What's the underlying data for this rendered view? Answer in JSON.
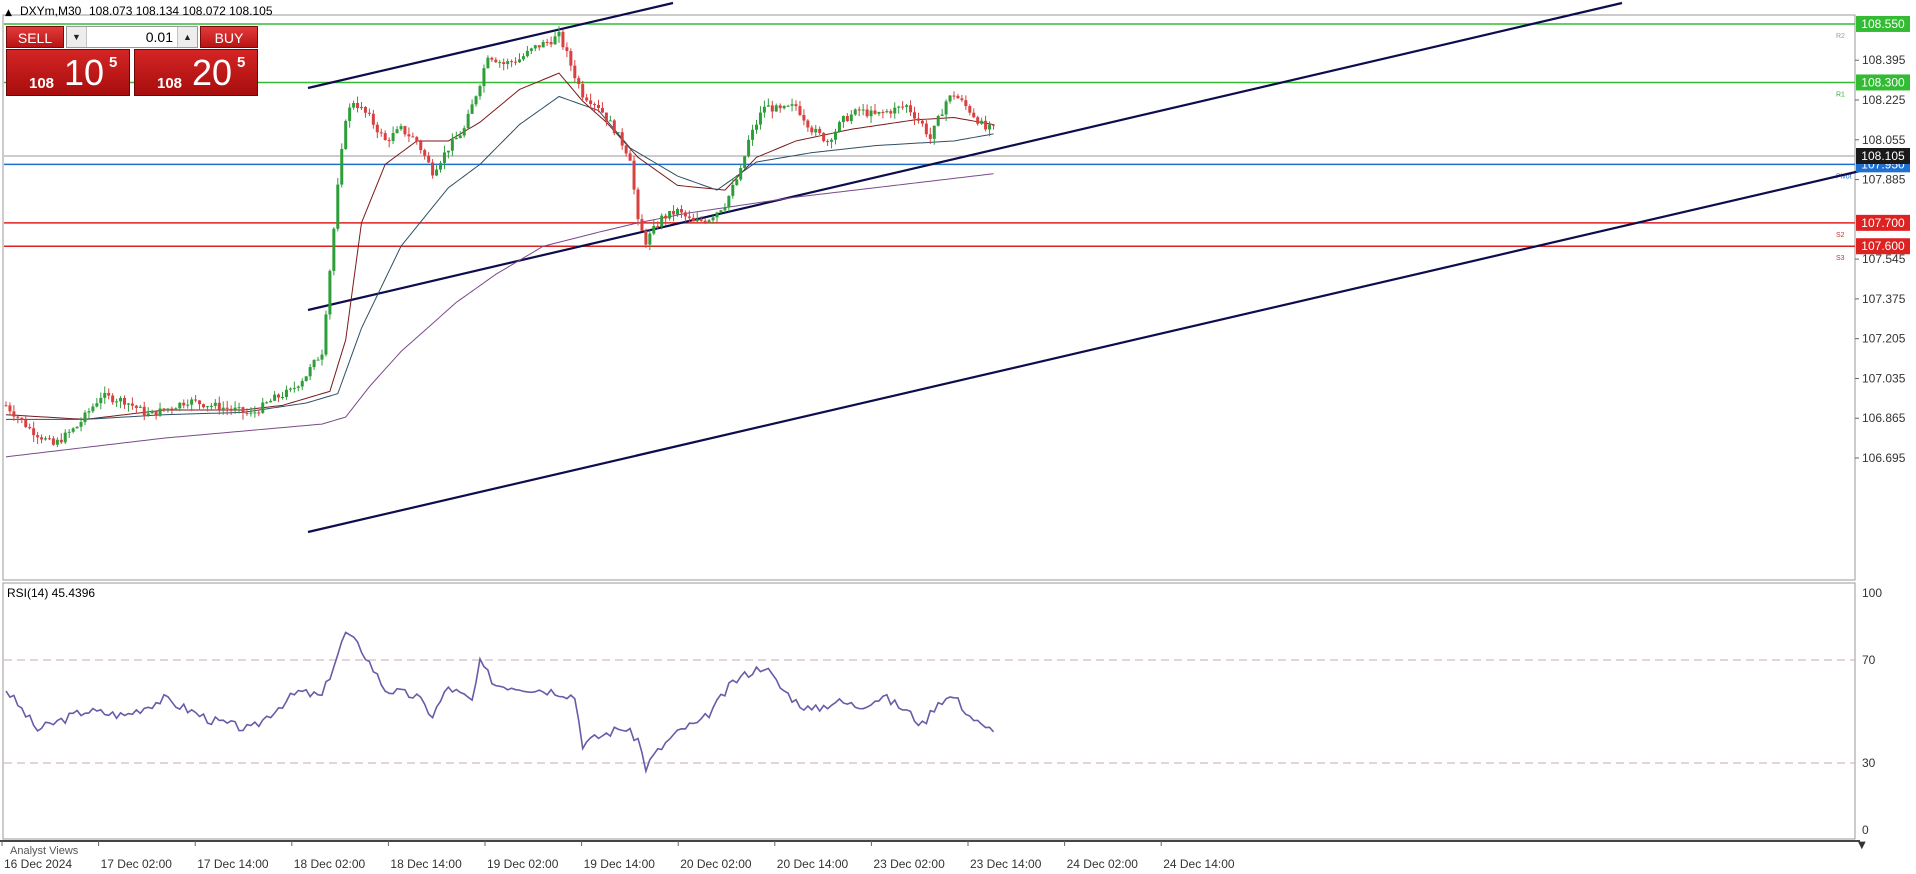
{
  "header": {
    "symbol": "DXYm,M30",
    "ohlc": "108.073 108.134 108.072 108.105"
  },
  "trade_panel": {
    "sell_label": "SELL",
    "buy_label": "BUY",
    "lot": "0.01",
    "bid_small": "108",
    "bid_big": "10",
    "bid_sup": "5",
    "ask_small": "108",
    "ask_big": "20",
    "ask_sup": "5"
  },
  "price_axis": {
    "ticks": [
      "108.395",
      "108.225",
      "108.055",
      "107.885",
      "107.545",
      "107.375",
      "107.205",
      "107.035",
      "106.865",
      "106.695"
    ],
    "current_price": "108.105"
  },
  "levels": [
    {
      "price": 108.55,
      "label": "108.550",
      "tag": "R2",
      "color": "#33bb33",
      "tag_color": "#88aa88"
    },
    {
      "price": 108.3,
      "label": "108.300",
      "tag": "R1",
      "color": "#33bb33",
      "tag_color": "#44aa44"
    },
    {
      "price": 107.95,
      "label": "107.950",
      "tag": "Pivot",
      "color": "#1f6fd1",
      "tag_color": "#1f6fd1"
    },
    {
      "price": 107.7,
      "label": "107.700",
      "tag": "S2",
      "color": "#dd2222",
      "tag_color": "#cc3333"
    },
    {
      "price": 107.6,
      "label": "107.600",
      "tag": "S3",
      "color": "#dd2222",
      "tag_color": "#cc3333"
    }
  ],
  "rsi": {
    "label": "RSI(14) 45.4396",
    "ticks": [
      "100",
      "70",
      "30",
      "0"
    ],
    "color": "#6b5aa8"
  },
  "time_axis": {
    "labels": [
      "16 Dec 2024",
      "17 Dec 02:00",
      "17 Dec 14:00",
      "18 Dec 02:00",
      "18 Dec 14:00",
      "19 Dec 02:00",
      "19 Dec 14:00",
      "20 Dec 02:00",
      "20 Dec 14:00",
      "23 Dec 02:00",
      "23 Dec 14:00",
      "24 Dec 02:00",
      "24 Dec 14:00"
    ]
  },
  "bottom_tab": "Analyst Views",
  "colors": {
    "bull": "#2e9e3a",
    "bear": "#d94040",
    "channel": "#0d0d4d",
    "ma_fast": "#7a1a1a",
    "ma_mid": "#2f4f66",
    "ma_slow": "#7a4a8a"
  },
  "chart_data": {
    "type": "candlestick",
    "series": [
      {
        "name": "",
        "anchors": [
          [
            0,
            106.92
          ],
          [
            6,
            106.82
          ],
          [
            12,
            106.75
          ],
          [
            18,
            106.83
          ],
          [
            24,
            106.96
          ],
          [
            30,
            106.94
          ],
          [
            36,
            106.88
          ],
          [
            40,
            106.9
          ],
          [
            46,
            106.94
          ],
          [
            52,
            106.92
          ],
          [
            58,
            106.9
          ],
          [
            62,
            106.88
          ],
          [
            68,
            106.95
          ],
          [
            72,
            106.98
          ],
          [
            76,
            107.05
          ],
          [
            80,
            107.15
          ],
          [
            84,
            107.85
          ],
          [
            86,
            108.15
          ],
          [
            88,
            108.22
          ],
          [
            92,
            108.15
          ],
          [
            96,
            108.05
          ],
          [
            100,
            108.1
          ],
          [
            104,
            108.05
          ],
          [
            108,
            107.92
          ],
          [
            112,
            108.02
          ],
          [
            116,
            108.1
          ],
          [
            120,
            108.3
          ],
          [
            122,
            108.42
          ],
          [
            126,
            108.38
          ],
          [
            130,
            108.4
          ],
          [
            134,
            108.45
          ],
          [
            138,
            108.48
          ],
          [
            140,
            108.5
          ],
          [
            142,
            108.42
          ],
          [
            144,
            108.33
          ],
          [
            146,
            108.25
          ],
          [
            150,
            108.2
          ],
          [
            154,
            108.1
          ],
          [
            158,
            107.98
          ],
          [
            160,
            107.7
          ],
          [
            162,
            107.62
          ],
          [
            166,
            107.72
          ],
          [
            170,
            107.75
          ],
          [
            174,
            107.7
          ],
          [
            178,
            107.72
          ],
          [
            182,
            107.78
          ],
          [
            186,
            107.92
          ],
          [
            188,
            108.05
          ],
          [
            192,
            108.2
          ],
          [
            196,
            108.18
          ],
          [
            200,
            108.2
          ],
          [
            204,
            108.1
          ],
          [
            208,
            108.05
          ],
          [
            212,
            108.14
          ],
          [
            216,
            108.18
          ],
          [
            220,
            108.16
          ],
          [
            224,
            108.18
          ],
          [
            228,
            108.2
          ],
          [
            232,
            108.12
          ],
          [
            234,
            108.06
          ],
          [
            238,
            108.22
          ],
          [
            240,
            108.25
          ],
          [
            244,
            108.18
          ],
          [
            248,
            108.1
          ],
          [
            250,
            108.105
          ]
        ]
      },
      {
        "name": "",
        "anchors": [
          [
            0,
            106.88
          ],
          [
            20,
            106.86
          ],
          [
            40,
            106.9
          ],
          [
            60,
            106.9
          ],
          [
            70,
            106.92
          ],
          [
            82,
            106.98
          ],
          [
            86,
            107.2
          ],
          [
            90,
            107.7
          ],
          [
            96,
            107.95
          ],
          [
            104,
            108.05
          ],
          [
            112,
            108.05
          ],
          [
            120,
            108.13
          ],
          [
            130,
            108.27
          ],
          [
            140,
            108.34
          ],
          [
            146,
            108.22
          ],
          [
            152,
            108.13
          ],
          [
            160,
            107.98
          ],
          [
            170,
            107.86
          ],
          [
            182,
            107.84
          ],
          [
            190,
            107.98
          ],
          [
            200,
            108.05
          ],
          [
            214,
            108.1
          ],
          [
            230,
            108.14
          ],
          [
            240,
            108.15
          ],
          [
            250,
            108.12
          ]
        ]
      },
      {
        "name": "",
        "anchors": [
          [
            0,
            106.86
          ],
          [
            20,
            106.86
          ],
          [
            40,
            106.88
          ],
          [
            60,
            106.89
          ],
          [
            76,
            106.93
          ],
          [
            84,
            106.97
          ],
          [
            90,
            107.25
          ],
          [
            100,
            107.6
          ],
          [
            112,
            107.85
          ],
          [
            120,
            107.95
          ],
          [
            130,
            108.12
          ],
          [
            140,
            108.24
          ],
          [
            150,
            108.18
          ],
          [
            158,
            108.02
          ],
          [
            170,
            107.9
          ],
          [
            180,
            107.84
          ],
          [
            190,
            107.96
          ],
          [
            204,
            108.0
          ],
          [
            220,
            108.03
          ],
          [
            240,
            108.05
          ],
          [
            250,
            108.08
          ]
        ]
      },
      {
        "name": "",
        "anchors": [
          [
            0,
            106.7
          ],
          [
            20,
            106.74
          ],
          [
            40,
            106.78
          ],
          [
            60,
            106.81
          ],
          [
            80,
            106.84
          ],
          [
            86,
            106.87
          ],
          [
            92,
            107.0
          ],
          [
            100,
            107.15
          ],
          [
            114,
            107.36
          ],
          [
            124,
            107.48
          ],
          [
            136,
            107.6
          ],
          [
            150,
            107.66
          ],
          [
            160,
            107.7
          ],
          [
            172,
            107.74
          ],
          [
            184,
            107.77
          ],
          [
            200,
            107.81
          ],
          [
            220,
            107.85
          ],
          [
            250,
            107.91
          ]
        ]
      }
    ],
    "rsi_anchors": [
      [
        0,
        61
      ],
      [
        8,
        44
      ],
      [
        20,
        52
      ],
      [
        30,
        50
      ],
      [
        40,
        57
      ],
      [
        52,
        48
      ],
      [
        62,
        44
      ],
      [
        70,
        55
      ],
      [
        74,
        60
      ],
      [
        80,
        58
      ],
      [
        86,
        85
      ],
      [
        90,
        78
      ],
      [
        96,
        61
      ],
      [
        104,
        58
      ],
      [
        108,
        50
      ],
      [
        112,
        62
      ],
      [
        118,
        56
      ],
      [
        120,
        72
      ],
      [
        124,
        63
      ],
      [
        130,
        62
      ],
      [
        140,
        60
      ],
      [
        144,
        58
      ],
      [
        146,
        38
      ],
      [
        150,
        41
      ],
      [
        156,
        45
      ],
      [
        160,
        40
      ],
      [
        162,
        28
      ],
      [
        164,
        33
      ],
      [
        168,
        40
      ],
      [
        172,
        45
      ],
      [
        176,
        47
      ],
      [
        180,
        55
      ],
      [
        184,
        64
      ],
      [
        188,
        68
      ],
      [
        192,
        71
      ],
      [
        196,
        62
      ],
      [
        200,
        56
      ],
      [
        204,
        52
      ],
      [
        210,
        56
      ],
      [
        216,
        54
      ],
      [
        222,
        58
      ],
      [
        228,
        52
      ],
      [
        232,
        46
      ],
      [
        236,
        56
      ],
      [
        240,
        58
      ],
      [
        244,
        50
      ],
      [
        248,
        44
      ],
      [
        250,
        45
      ]
    ],
    "rsi_ylim": [
      0,
      100
    ]
  }
}
